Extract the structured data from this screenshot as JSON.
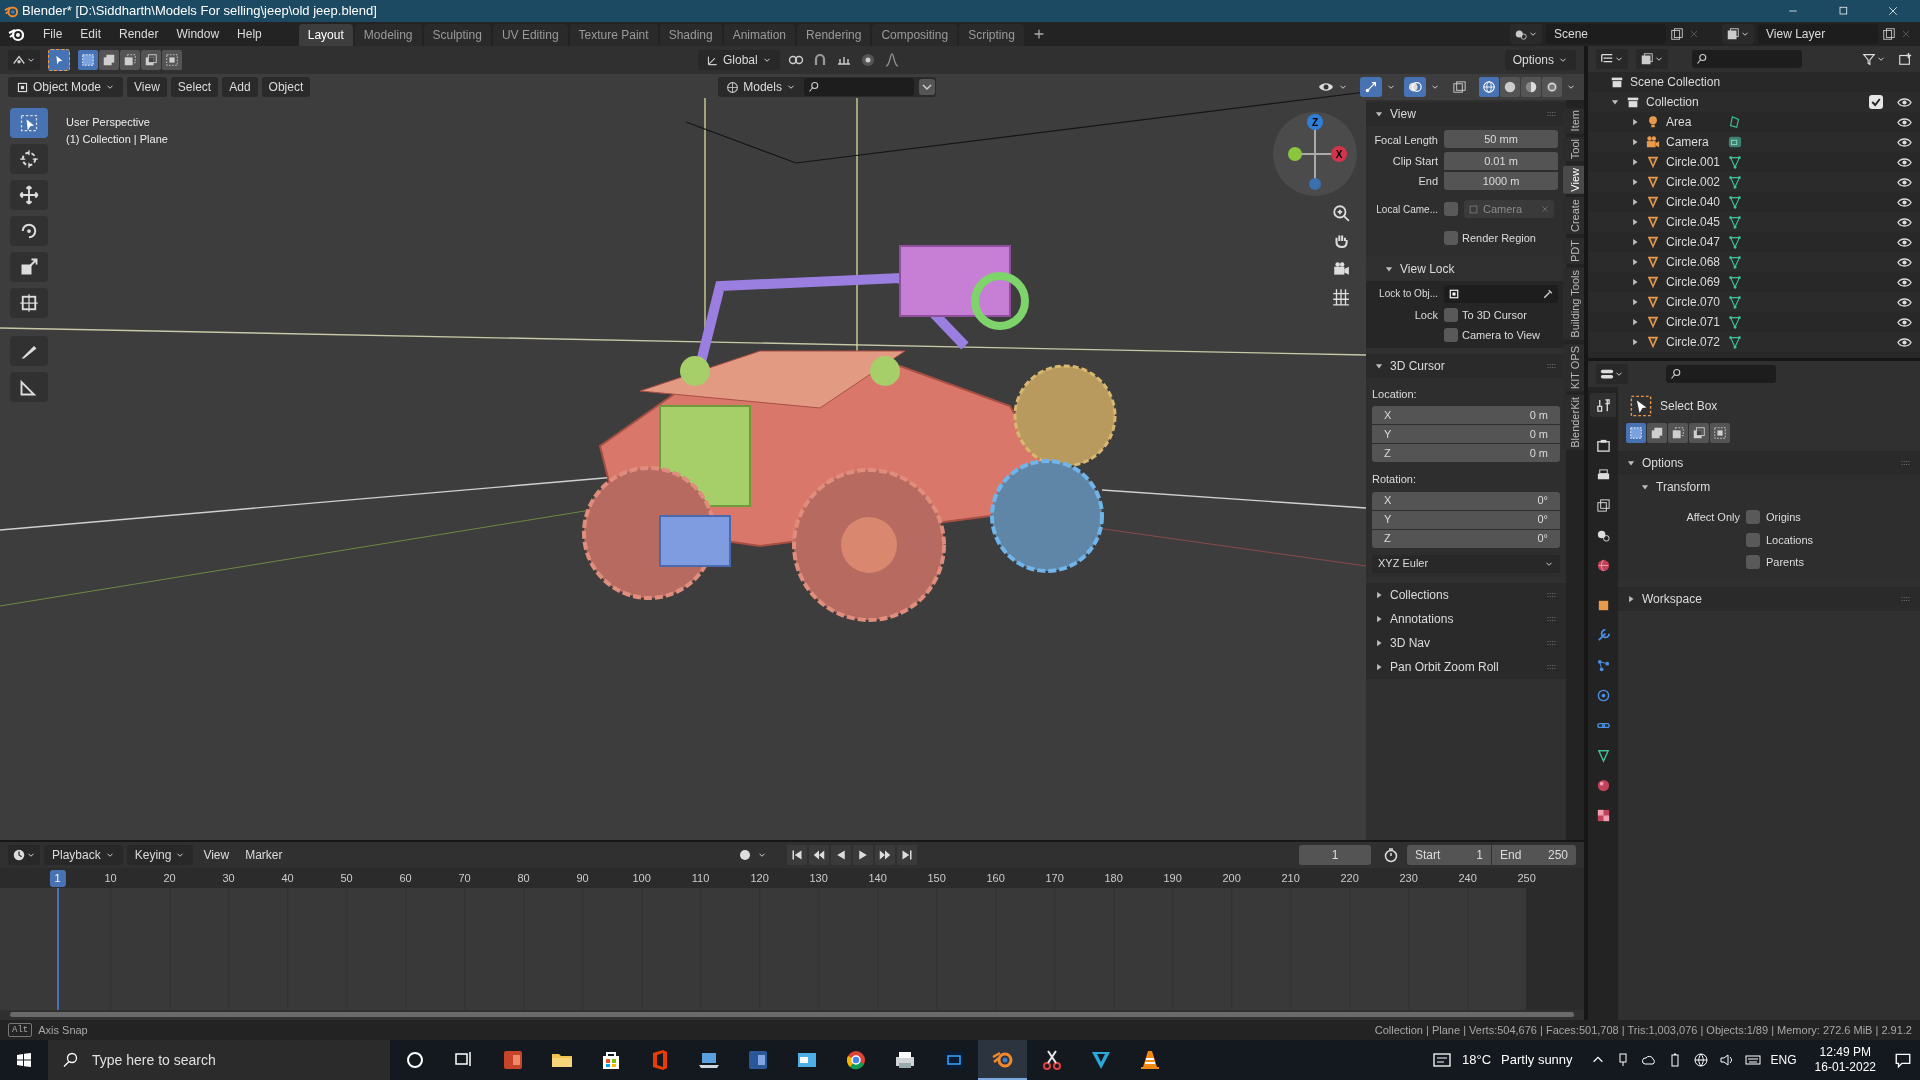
{
  "window": {
    "title": "Blender* [D:\\Siddharth\\Models For selling\\jeep\\old jeep.blend]"
  },
  "menu": [
    "File",
    "Edit",
    "Render",
    "Window",
    "Help"
  ],
  "workspace_tabs": [
    {
      "label": "Layout",
      "selected": true
    },
    {
      "label": "Modeling",
      "selected": false
    },
    {
      "label": "Sculpting",
      "selected": false
    },
    {
      "label": "UV Editing",
      "selected": false
    },
    {
      "label": "Texture Paint",
      "selected": false
    },
    {
      "label": "Shading",
      "selected": false
    },
    {
      "label": "Animation",
      "selected": false
    },
    {
      "label": "Rendering",
      "selected": false
    },
    {
      "label": "Compositing",
      "selected": false
    },
    {
      "label": "Scripting",
      "selected": false
    }
  ],
  "scene": "Scene",
  "view_layer": "View Layer",
  "select_modes": [
    {
      "selected": true
    },
    {
      "selected": false
    },
    {
      "selected": false
    },
    {
      "selected": false
    },
    {
      "selected": false
    }
  ],
  "tool_header": {
    "orientation": "Global",
    "options": "Options"
  },
  "viewport_header": {
    "mode": "Object Mode",
    "menus": [
      "View",
      "Select",
      "Add",
      "Object"
    ],
    "collection": "Models"
  },
  "shading_modes": [
    {
      "kind": "wireframe",
      "selected": true
    },
    {
      "kind": "solid",
      "selected": false
    },
    {
      "kind": "material",
      "selected": false
    },
    {
      "kind": "rendered",
      "selected": false
    }
  ],
  "viewport_info": [
    "User Perspective",
    "(1) Collection | Plane"
  ],
  "tools": [
    {
      "kind": "select",
      "selected": true
    },
    {
      "kind": "cursor",
      "selected": false
    },
    {
      "kind": "move",
      "selected": false
    },
    {
      "kind": "rotate",
      "selected": false
    },
    {
      "kind": "scale",
      "selected": false
    },
    {
      "kind": "transform",
      "selected": false
    },
    {
      "kind": "annotate",
      "selected": false
    },
    {
      "kind": "measure",
      "selected": false
    }
  ],
  "gizmo_labels": [
    "Z",
    "X"
  ],
  "sidebar_tabs": [
    {
      "label": "Item",
      "selected": false
    },
    {
      "label": "Tool",
      "selected": false
    },
    {
      "label": "View",
      "selected": true
    },
    {
      "label": "Create",
      "selected": false
    },
    {
      "label": "PDT",
      "selected": false
    },
    {
      "label": "Building Tools",
      "selected": false
    },
    {
      "label": "KIT OPS",
      "selected": false
    },
    {
      "label": "BlenderKit",
      "selected": false
    }
  ],
  "view_panel": {
    "title": "View",
    "expanded": true,
    "fields": [
      {
        "label": "Focal Length",
        "value": "50 mm"
      },
      {
        "label": "Clip Start",
        "value": "0.01 m"
      },
      {
        "label": "End",
        "value": "1000 m"
      }
    ],
    "local_camera": {
      "label": "Local Came...",
      "checked": false,
      "value": "Camera"
    },
    "render_region": {
      "label": "Render Region",
      "checked": false
    },
    "view_lock": {
      "title": "View Lock",
      "expanded": true,
      "lock_to_object": "Lock to Obj...",
      "lock_label": "Lock",
      "options": [
        {
          "label": "To 3D Cursor",
          "checked": false
        },
        {
          "label": "Camera to View",
          "checked": false
        }
      ]
    }
  },
  "cursor_panel": {
    "title": "3D Cursor",
    "expanded": true,
    "location_label": "Location:",
    "location": [
      {
        "axis": "X",
        "value": "0 m"
      },
      {
        "axis": "Y",
        "value": "0 m"
      },
      {
        "axis": "Z",
        "value": "0 m"
      }
    ],
    "rotation_label": "Rotation:",
    "rotation": [
      {
        "axis": "X",
        "value": "0°"
      },
      {
        "axis": "Y",
        "value": "0°"
      },
      {
        "axis": "Z",
        "value": "0°"
      }
    ],
    "rotation_mode": "XYZ Euler"
  },
  "collapsed_panels": [
    {
      "title": "Collections",
      "expanded": false
    },
    {
      "title": "Annotations",
      "expanded": false
    },
    {
      "title": "3D Nav",
      "expanded": false
    },
    {
      "title": "Pan Orbit Zoom Roll",
      "expanded": false
    }
  ],
  "outliner": {
    "root": "Scene Collection",
    "items": [
      {
        "label": "Collection",
        "kind": "collection",
        "expanded": true,
        "checked": true,
        "children": [
          {
            "label": "Area",
            "kind": "light",
            "expanded": false
          },
          {
            "label": "Camera",
            "kind": "camera",
            "expanded": false
          },
          {
            "label": "Circle.001",
            "kind": "mesh",
            "expanded": false
          },
          {
            "label": "Circle.002",
            "kind": "mesh",
            "expanded": false
          },
          {
            "label": "Circle.040",
            "kind": "mesh",
            "expanded": false
          },
          {
            "label": "Circle.045",
            "kind": "mesh",
            "expanded": false
          },
          {
            "label": "Circle.047",
            "kind": "mesh",
            "expanded": false
          },
          {
            "label": "Circle.068",
            "kind": "mesh",
            "expanded": false
          },
          {
            "label": "Circle.069",
            "kind": "mesh",
            "expanded": false
          },
          {
            "label": "Circle.070",
            "kind": "mesh",
            "expanded": false
          },
          {
            "label": "Circle.071",
            "kind": "mesh",
            "expanded": false
          },
          {
            "label": "Circle.072",
            "kind": "mesh",
            "expanded": false
          }
        ]
      }
    ]
  },
  "properties": {
    "tabs": [
      {
        "kind": "tool",
        "selected": true
      },
      {
        "kind": "render",
        "selected": false
      },
      {
        "kind": "output",
        "selected": false
      },
      {
        "kind": "view_layer",
        "selected": false
      },
      {
        "kind": "scene",
        "selected": false
      },
      {
        "kind": "world",
        "selected": false
      },
      {
        "kind": "object",
        "selected": false
      },
      {
        "kind": "modifier",
        "selected": false
      },
      {
        "kind": "particles",
        "selected": false
      },
      {
        "kind": "physics",
        "selected": false
      },
      {
        "kind": "constraints",
        "selected": false
      },
      {
        "kind": "data",
        "selected": false
      },
      {
        "kind": "material",
        "selected": false
      },
      {
        "kind": "texture",
        "selected": false
      }
    ],
    "tool_name": "Select Box",
    "modes": [
      {
        "selected": true
      },
      {
        "selected": false
      },
      {
        "selected": false
      },
      {
        "selected": false
      },
      {
        "selected": false
      }
    ],
    "options": {
      "title": "Options",
      "expanded": true
    },
    "transform": {
      "title": "Transform",
      "expanded": true,
      "affect_label": "Affect Only",
      "items": [
        {
          "label": "Origins",
          "checked": false
        },
        {
          "label": "Locations",
          "checked": false
        },
        {
          "label": "Parents",
          "checked": false
        }
      ]
    },
    "workspace": {
      "title": "Workspace",
      "expanded": false
    }
  },
  "timeline": {
    "menus": [
      "Playback",
      "Keying",
      "View",
      "Marker"
    ],
    "current_frame": "1",
    "start_label": "Start",
    "start": "1",
    "end_label": "End",
    "end": "250",
    "ruler": [
      "1",
      "10",
      "20",
      "30",
      "40",
      "50",
      "60",
      "70",
      "80",
      "90",
      "100",
      "110",
      "120",
      "130",
      "140",
      "150",
      "160",
      "170",
      "180",
      "190",
      "200",
      "210",
      "220",
      "230",
      "240",
      "250"
    ]
  },
  "status_bar": {
    "key": "Alt",
    "hint": "Axis Snap",
    "stats": "Collection | Plane | Verts:504,676 | Faces:501,708 | Tris:1,003,076 | Objects:1/89 | Memory: 272.6 MiB | 2.91.2"
  },
  "taskbar": {
    "search_placeholder": "Type here to search",
    "apps": [
      {
        "kind": "circle",
        "selected": false
      },
      {
        "kind": "taskview",
        "selected": false
      },
      {
        "kind": "slides",
        "selected": false
      },
      {
        "kind": "folder",
        "selected": false
      },
      {
        "kind": "bag",
        "selected": false
      },
      {
        "kind": "office",
        "selected": false
      },
      {
        "kind": "laptop",
        "selected": false
      },
      {
        "kind": "document",
        "selected": false
      },
      {
        "kind": "window",
        "selected": false
      },
      {
        "kind": "browser",
        "selected": false
      },
      {
        "kind": "printer",
        "selected": false
      },
      {
        "kind": "image",
        "selected": false
      },
      {
        "kind": "blender",
        "selected": true
      },
      {
        "kind": "scissors",
        "selected": false
      },
      {
        "kind": "vee",
        "selected": false
      },
      {
        "kind": "cone",
        "selected": false
      }
    ],
    "temperature": "18°C",
    "weather": "Partly sunny",
    "language": "ENG",
    "time": "12:49 PM",
    "date": "16-01-2022"
  }
}
